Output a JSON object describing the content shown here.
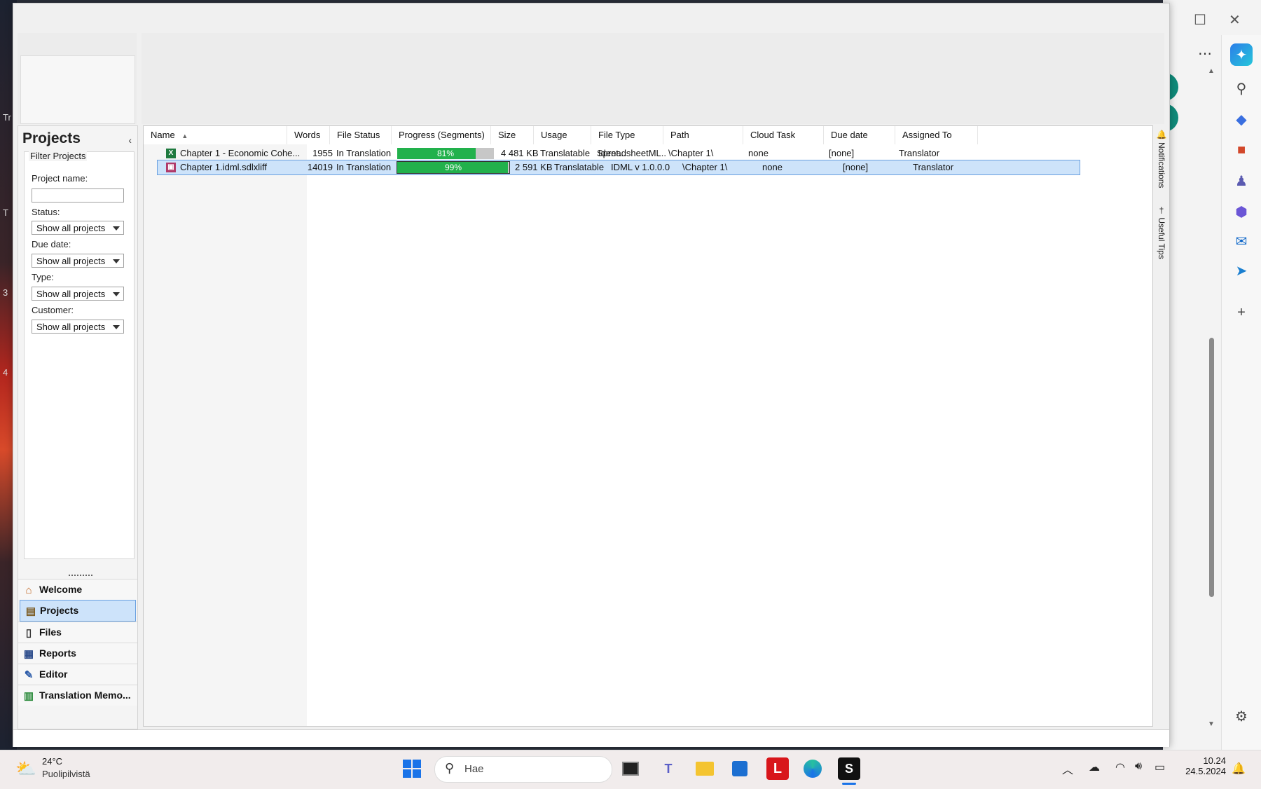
{
  "projects_panel": {
    "title": "Projects",
    "filter": {
      "title": "Filter Projects",
      "project_name_label": "Project name:",
      "project_name_value": "",
      "status_label": "Status:",
      "status_value": "Show all projects",
      "due_date_label": "Due date:",
      "due_date_value": "Show all projects",
      "type_label": "Type:",
      "type_value": "Show all projects",
      "customer_label": "Customer:",
      "customer_value": "Show all projects"
    }
  },
  "nav": {
    "items": [
      {
        "label": "Welcome",
        "icon": "home-icon"
      },
      {
        "label": "Projects",
        "icon": "projects-icon",
        "selected": true
      },
      {
        "label": "Files",
        "icon": "files-icon"
      },
      {
        "label": "Reports",
        "icon": "reports-icon"
      },
      {
        "label": "Editor",
        "icon": "pencil-icon"
      },
      {
        "label": "Translation Memo...",
        "icon": "translation-memory-icon"
      }
    ]
  },
  "grid": {
    "columns": [
      "Name",
      "Words",
      "File Status",
      "Progress (Segments)",
      "Size",
      "Usage",
      "File Type Ident...",
      "Path",
      "Cloud Task",
      "Due date",
      "Assigned To"
    ],
    "rows": [
      {
        "name": "Chapter 1 - Economic Cohe...",
        "words": "1955",
        "status": "In Translation",
        "progress": 81,
        "progress_label": "81%",
        "size": "4 481 KB",
        "usage": "Translatable",
        "filetype": "SpreadsheetML...",
        "path": "\\Chapter 1\\",
        "cloud": "none",
        "due": "[none]",
        "assigned": "Translator",
        "icon": "excel-icon"
      },
      {
        "name": "Chapter 1.idml.sdlxliff",
        "words": "14019",
        "status": "In Translation",
        "progress": 99,
        "progress_label": "99%",
        "size": "2 591 KB",
        "usage": "Translatable",
        "filetype": "IDML v 1.0.0.0",
        "path": "\\Chapter 1\\",
        "cloud": "none",
        "due": "[none]",
        "assigned": "Translator",
        "icon": "idml-icon",
        "selected": true
      }
    ]
  },
  "side_tabs": [
    "Notifications",
    "Useful Tips"
  ],
  "desktop_letters": [
    "Tr",
    "T",
    "3",
    "4"
  ],
  "taskbar": {
    "weather_temp": "24°C",
    "weather_condition": "Puolipilvistä",
    "search_placeholder": "Hae",
    "time": "10.24",
    "date": "24.5.2024"
  }
}
